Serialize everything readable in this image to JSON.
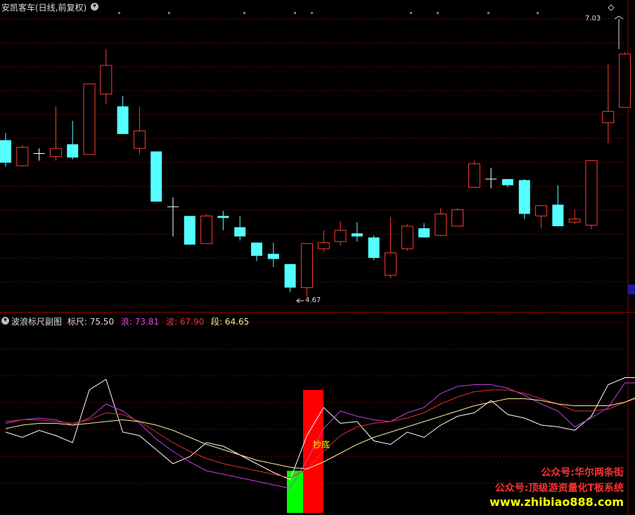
{
  "main_panel": {
    "title": "安凯客车(日线,前复权)",
    "high_label": "7.03",
    "low_label": "4.67"
  },
  "sub_panel": {
    "title": "波浪标尺副图",
    "indicators": [
      {
        "label": "标尺:",
        "value": "75.50",
        "color": "#e0e0e0"
      },
      {
        "label": "浪:",
        "value": "73.81",
        "color": "#d14fd6"
      },
      {
        "label": "波:",
        "value": "67.90",
        "color": "#e03a3a"
      },
      {
        "label": "段:",
        "value": "64.65",
        "color": "#f0f0a0"
      }
    ],
    "signal_label": "抄底"
  },
  "promo": {
    "line1": "公众号:华尔两条街",
    "line2": "公众号:顶级游资量化T板系统",
    "line3": "www.zhibiao888.com"
  },
  "colors": {
    "up": "#ff3b30",
    "down": "#55ffff",
    "grid": "#7a0000",
    "line_white": "#ffffff",
    "line_magenta": "#c040e0",
    "line_red": "#e03030",
    "line_yellow": "#f5f0a0",
    "bar_green": "#00ff00",
    "bar_red": "#ff0000",
    "promo_red": "#ff3030",
    "promo_yellow": "#ffff00"
  },
  "chart_data": [
    {
      "type": "candlestick",
      "ylim": [
        4.4,
        7.35
      ],
      "candles": [
        {
          "o": 6.05,
          "h": 6.12,
          "l": 5.79,
          "c": 5.83
        },
        {
          "o": 5.8,
          "h": 6.0,
          "l": 5.79,
          "c": 5.98
        },
        {
          "o": 5.92,
          "h": 5.97,
          "l": 5.85,
          "c": 5.92
        },
        {
          "o": 5.89,
          "h": 6.38,
          "l": 5.85,
          "c": 5.97
        },
        {
          "o": 6.01,
          "h": 6.24,
          "l": 5.86,
          "c": 5.88
        },
        {
          "o": 5.91,
          "h": 6.6,
          "l": 5.91,
          "c": 6.6
        },
        {
          "o": 6.5,
          "h": 6.94,
          "l": 6.4,
          "c": 6.78
        },
        {
          "o": 6.38,
          "h": 6.48,
          "l": 6.11,
          "c": 6.11
        },
        {
          "o": 5.97,
          "h": 6.38,
          "l": 5.91,
          "c": 6.14
        },
        {
          "o": 5.94,
          "h": 5.94,
          "l": 5.45,
          "c": 5.45
        },
        {
          "o": 5.39,
          "h": 5.49,
          "l": 5.11,
          "c": 5.4
        },
        {
          "o": 5.31,
          "h": 5.31,
          "l": 5.03,
          "c": 5.03
        },
        {
          "o": 5.04,
          "h": 5.33,
          "l": 5.04,
          "c": 5.31
        },
        {
          "o": 5.31,
          "h": 5.36,
          "l": 5.17,
          "c": 5.29
        },
        {
          "o": 5.2,
          "h": 5.31,
          "l": 5.07,
          "c": 5.11
        },
        {
          "o": 5.05,
          "h": 5.05,
          "l": 4.87,
          "c": 4.92
        },
        {
          "o": 4.94,
          "h": 5.05,
          "l": 4.81,
          "c": 4.89
        },
        {
          "o": 4.84,
          "h": 4.84,
          "l": 4.57,
          "c": 4.61
        },
        {
          "o": 4.61,
          "h": 5.04,
          "l": 4.52,
          "c": 5.04
        },
        {
          "o": 4.99,
          "h": 5.17,
          "l": 4.96,
          "c": 5.05
        },
        {
          "o": 5.06,
          "h": 5.26,
          "l": 5.02,
          "c": 5.17
        },
        {
          "o": 5.14,
          "h": 5.25,
          "l": 5.06,
          "c": 5.11
        },
        {
          "o": 5.1,
          "h": 5.12,
          "l": 4.88,
          "c": 4.9
        },
        {
          "o": 4.73,
          "h": 5.3,
          "l": 4.7,
          "c": 4.95
        },
        {
          "o": 4.99,
          "h": 5.23,
          "l": 4.97,
          "c": 5.21
        },
        {
          "o": 5.19,
          "h": 5.24,
          "l": 5.1,
          "c": 5.1
        },
        {
          "o": 5.12,
          "h": 5.39,
          "l": 5.11,
          "c": 5.33
        },
        {
          "o": 5.21,
          "h": 5.39,
          "l": 5.21,
          "c": 5.37
        },
        {
          "o": 5.59,
          "h": 5.85,
          "l": 5.59,
          "c": 5.82
        },
        {
          "o": 5.67,
          "h": 5.78,
          "l": 5.58,
          "c": 5.67
        },
        {
          "o": 5.67,
          "h": 5.67,
          "l": 5.59,
          "c": 5.61
        },
        {
          "o": 5.66,
          "h": 5.67,
          "l": 5.28,
          "c": 5.33
        },
        {
          "o": 5.31,
          "h": 5.41,
          "l": 5.19,
          "c": 5.41
        },
        {
          "o": 5.42,
          "h": 5.61,
          "l": 5.21,
          "c": 5.21
        },
        {
          "o": 5.25,
          "h": 5.37,
          "l": 5.23,
          "c": 5.28
        },
        {
          "o": 5.22,
          "h": 5.85,
          "l": 5.18,
          "c": 5.85
        },
        {
          "o": 6.22,
          "h": 6.79,
          "l": 6.02,
          "c": 6.33
        },
        {
          "o": 6.37,
          "h": 6.91,
          "l": 6.37,
          "c": 6.89
        },
        {
          "o": 6.62,
          "h": 7.03,
          "l": 6.5,
          "c": 6.84
        }
      ]
    },
    {
      "type": "line",
      "ylim": [
        0,
        100
      ],
      "bars": [
        {
          "index": 17,
          "color": "bar_green",
          "value": 22
        },
        {
          "index": 18,
          "color": "bar_red",
          "value": 68
        }
      ],
      "series": [
        {
          "color": "line_white",
          "values": [
            44,
            41,
            45,
            42,
            38,
            68,
            74,
            44,
            42,
            34,
            26,
            30,
            38,
            36,
            31,
            26,
            21,
            17,
            42,
            58,
            49,
            50,
            39,
            37,
            44,
            41,
            48,
            53,
            55,
            62,
            54,
            52,
            48,
            47,
            45,
            53,
            71,
            75,
            75
          ]
        },
        {
          "color": "line_magenta",
          "values": [
            49,
            51,
            52,
            51,
            48,
            52,
            60,
            56,
            49,
            40,
            33,
            27,
            22,
            20,
            18,
            16,
            14,
            12,
            28,
            46,
            56,
            53,
            51,
            50,
            55,
            58,
            66,
            70,
            71,
            71,
            69,
            65,
            60,
            56,
            47,
            52,
            58,
            72,
            72
          ]
        },
        {
          "color": "line_red",
          "values": [
            50,
            51,
            51,
            50,
            49,
            51,
            55,
            54,
            50,
            44,
            38,
            33,
            29,
            26,
            24,
            22,
            20,
            18,
            23,
            33,
            42,
            47,
            49,
            50,
            52,
            55,
            60,
            64,
            67,
            68,
            68,
            66,
            63,
            60,
            56,
            56,
            57,
            61,
            64
          ]
        },
        {
          "color": "line_yellow",
          "values": [
            46,
            48,
            49,
            49,
            48,
            49,
            50,
            51,
            50,
            48,
            45,
            41,
            37,
            34,
            31,
            28,
            26,
            24,
            23,
            27,
            32,
            37,
            41,
            44,
            47,
            50,
            53,
            56,
            59,
            61,
            63,
            63,
            62,
            60,
            59,
            59,
            59,
            61,
            65
          ]
        }
      ]
    }
  ]
}
